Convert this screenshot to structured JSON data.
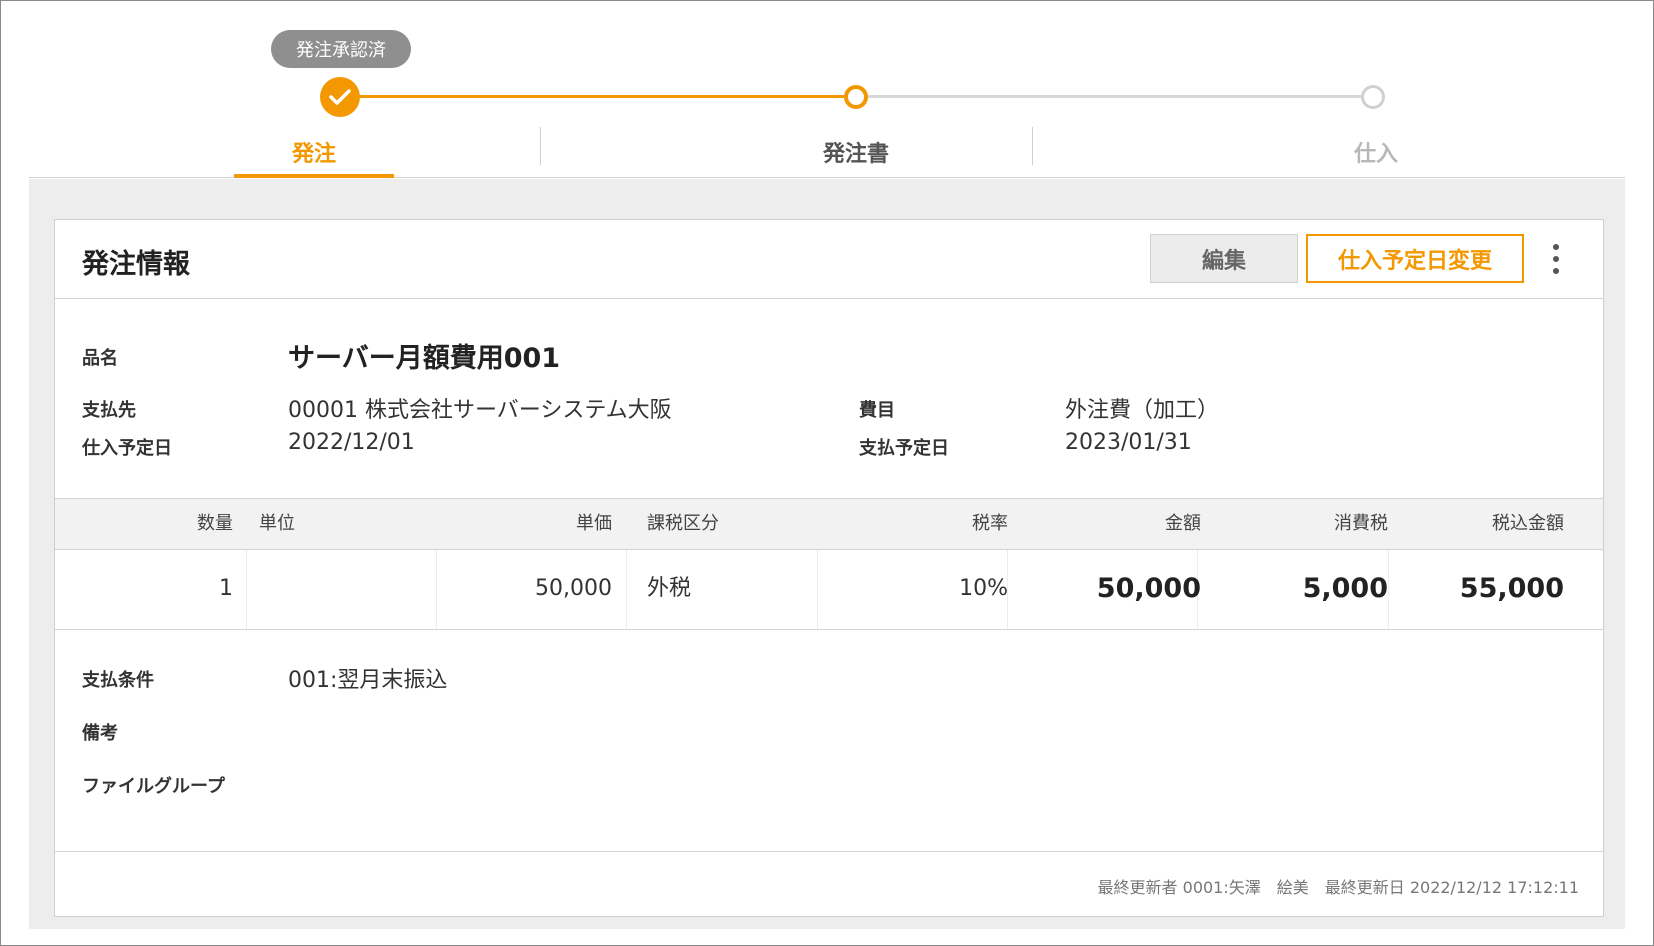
{
  "stepper": {
    "status_pill": "発注承認済",
    "steps": [
      {
        "label": "発注",
        "state": "active-complete"
      },
      {
        "label": "発注書",
        "state": "current"
      },
      {
        "label": "仕入",
        "state": "pending"
      }
    ],
    "accent_color": "#f39800"
  },
  "card": {
    "title": "発注情報",
    "edit_label": "編集",
    "change_date_label": "仕入予定日変更",
    "more_icon": "more-vertical-icon"
  },
  "details": {
    "item_name_label": "品名",
    "item_name": "サーバー月額費用001",
    "payee_label": "支払先",
    "payee": "00001 株式会社サーバーシステム大阪",
    "expense_label": "費目",
    "expense": "外注費（加工）",
    "purchase_date_label": "仕入予定日",
    "purchase_date": "2022/12/01",
    "payment_date_label": "支払予定日",
    "payment_date": "2023/01/31"
  },
  "table": {
    "headers": {
      "quantity": "数量",
      "unit": "単位",
      "unit_price": "単価",
      "tax_class": "課税区分",
      "tax_rate": "税率",
      "amount": "金額",
      "tax": "消費税",
      "total": "税込金額"
    },
    "row": {
      "quantity": "1",
      "unit": "",
      "unit_price": "50,000",
      "tax_class": "外税",
      "tax_rate": "10%",
      "amount": "50,000",
      "tax": "5,000",
      "total": "55,000"
    }
  },
  "extra": {
    "payment_terms_label": "支払条件",
    "payment_terms": "001:翌月末振込",
    "remarks_label": "備考",
    "remarks": "",
    "file_group_label": "ファイルグループ",
    "file_group": ""
  },
  "footer": {
    "last_updated": "最終更新者 0001:矢澤　絵美　最終更新日 2022/12/12 17:12:11"
  }
}
